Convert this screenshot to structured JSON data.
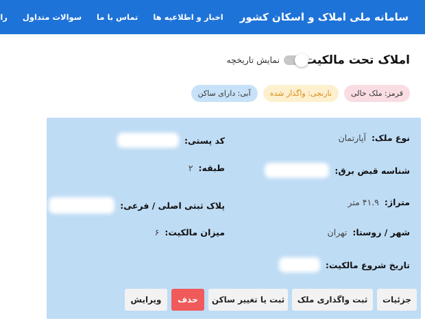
{
  "header": {
    "site_title": "سامانه ملی املاک و اسکان کشور",
    "nav": [
      {
        "label": "اخبار و اطلاعیه ها"
      },
      {
        "label": "تماس با ما"
      },
      {
        "label": "سوالات متداول"
      },
      {
        "label": "راهنما"
      }
    ]
  },
  "page": {
    "title": "املاک تحت مالکیت",
    "history_toggle_label": "نمایش تاریخچه",
    "history_toggle_on": false
  },
  "legend": [
    {
      "label": "قرمز: ملک خالی",
      "color": "#f9dde3"
    },
    {
      "label": "نارنجی: واگذار شده",
      "color": "#fdf0cf"
    },
    {
      "label": "آبی: دارای ساکن",
      "color": "#c7e2f8"
    }
  ],
  "property": {
    "type_label": "نوع ملک:",
    "type_value": "آپارتمان",
    "postal_code_label": "کد پستی:",
    "meter_id_label": "شناسه قبض برق:",
    "floor_label": "طبقه:",
    "floor_value": "۲",
    "area_label": "متراژ:",
    "area_value": "۴۱.۹ متر",
    "plate_label": "پلاک ثبتی اصلی / فرعی:",
    "city_label": "شهر / روستا:",
    "city_value": "تهران",
    "ownership_share_label": "میزان مالکیت:",
    "ownership_share_value": "۶",
    "ownership_start_label": "تاریخ شروع مالکیت:"
  },
  "actions": {
    "details": "جزئیات",
    "transfer": "ثبت واگذاری ملک",
    "resident": "ثبت یا تغییر ساکن",
    "delete": "حذف",
    "edit": "ویرایش"
  },
  "colors": {
    "header_bg": "#1e73d8",
    "card_bg": "#bfdcf5",
    "danger": "#f05a5a"
  }
}
